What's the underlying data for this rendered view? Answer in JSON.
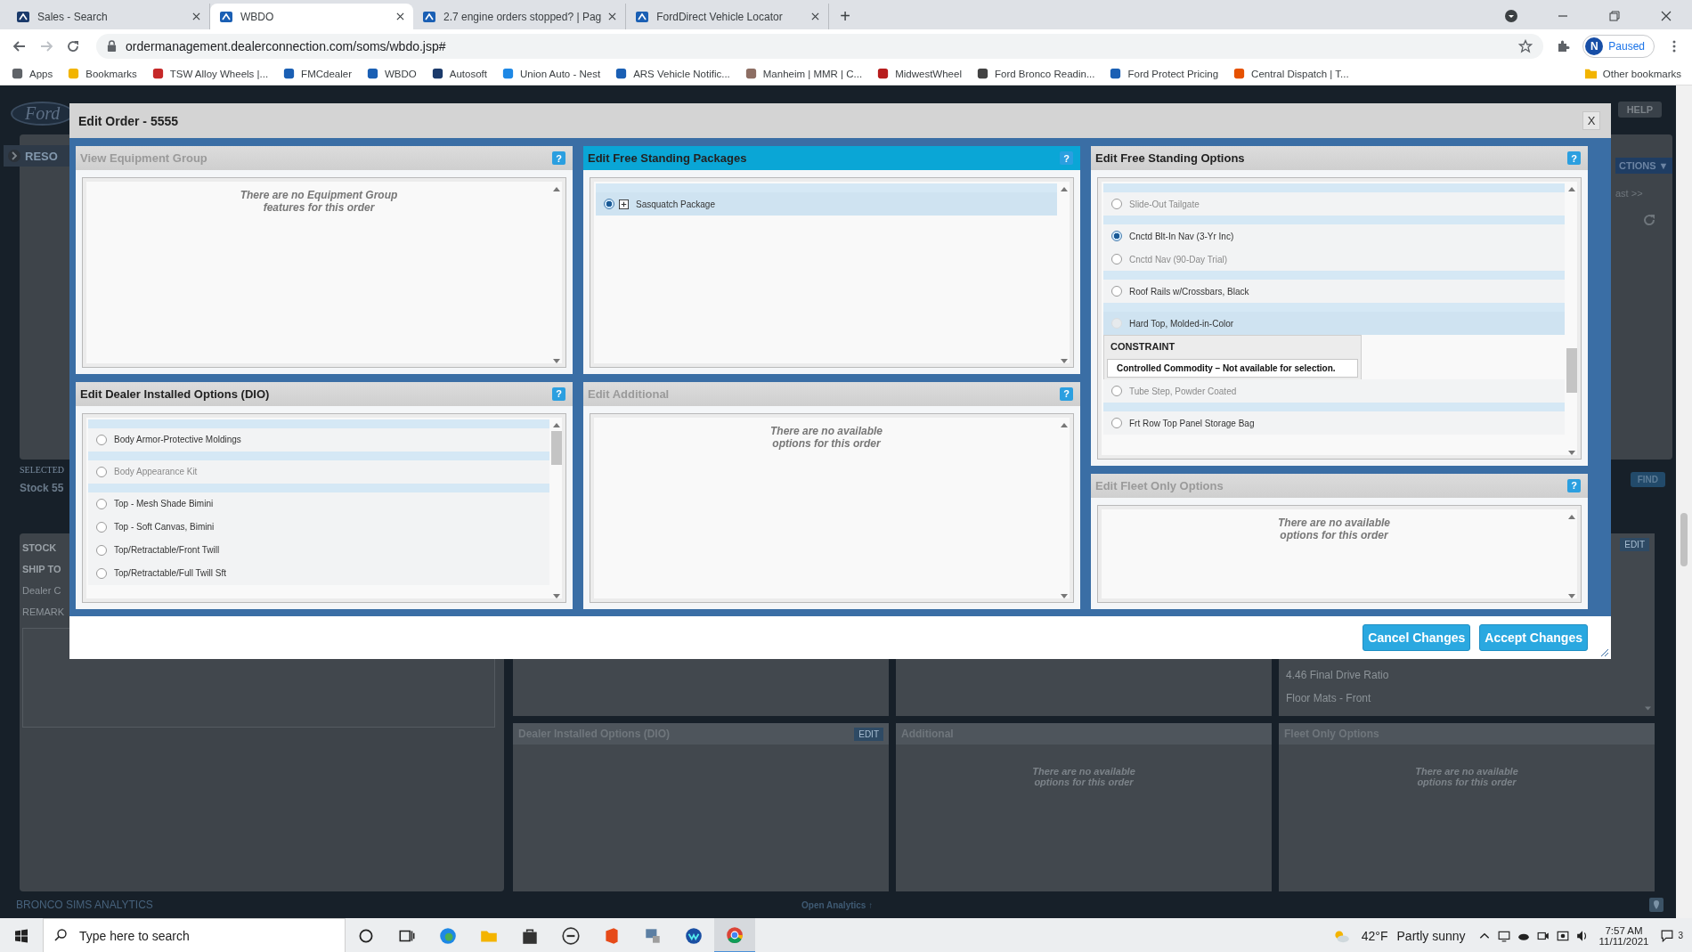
{
  "browser": {
    "tabs": [
      {
        "title": "Sales - Search",
        "selected": false
      },
      {
        "title": "WBDO",
        "selected": true
      },
      {
        "title": "2.7 engine orders stopped? | Pag",
        "selected": false
      },
      {
        "title": "FordDirect Vehicle Locator",
        "selected": false
      }
    ],
    "new_tab": "+",
    "address": "ordermanagement.dealerconnection.com/soms/wbdo.jsp#",
    "profile": {
      "initial": "N",
      "status": "Paused"
    },
    "bookmarks": [
      "Apps",
      "Bookmarks",
      "TSW Alloy Wheels |...",
      "FMCdealer",
      "WBDO",
      "Autosoft",
      "Union Auto - Nest",
      "ARS Vehicle Notific...",
      "Manheim | MMR | C...",
      "MidwestWheel",
      "Ford Bronco Readin...",
      "Ford Protect Pricing",
      "Central Dispatch | T..."
    ],
    "other_bookmarks": "Other bookmarks"
  },
  "page": {
    "logo": "Ford",
    "help": "HELP",
    "sidebar_button": "RESO",
    "actions": "CTIONS ▼",
    "last": "ast >>",
    "selected_label": "SELECTED",
    "stock_title": "Stock 55",
    "find": "FIND",
    "details": [
      "STOCK",
      "SHIP TO",
      "Dealer C",
      "REMARK"
    ],
    "features_edit": "EDIT",
    "features": [
      "4.46 Final Drive Ratio",
      "Floor Mats - Front"
    ],
    "cards": [
      {
        "title": "Dealer Installed Options (DIO)",
        "edit": "EDIT"
      },
      {
        "title": "Additional",
        "message": "There are no available\noptions for this order"
      },
      {
        "title": "Fleet Only Options",
        "message": "There are no available\noptions for this order"
      }
    ],
    "analytics": "BRONCO SIMS ANALYTICS",
    "open_analytics": "Open Analytics ↑"
  },
  "dialog": {
    "title": "Edit Order - 5555",
    "close": "X",
    "columns": [
      [
        {
          "title": "View Equipment Group",
          "selected": false,
          "disabled": true,
          "help": "?",
          "kind": "message",
          "message": "There are no Equipment Group\nfeatures for this order"
        },
        {
          "title": "Edit Dealer Installed Options (DIO)",
          "selected": false,
          "disabled": false,
          "help": "?",
          "kind": "options",
          "groups": [
            [
              {
                "label": "Body Armor-Protective Moldings",
                "selected": false,
                "disabled": false,
                "highlighted": false
              }
            ],
            [
              {
                "label": "Body Appearance Kit",
                "selected": false,
                "disabled": true,
                "highlighted": false
              }
            ],
            [
              {
                "label": "Top - Mesh Shade Bimini",
                "selected": false,
                "disabled": false,
                "highlighted": false
              },
              {
                "label": "Top - Soft Canvas, Bimini",
                "selected": false,
                "disabled": false,
                "highlighted": false
              },
              {
                "label": "Top/Retractable/Front Twill",
                "selected": false,
                "disabled": false,
                "highlighted": false
              },
              {
                "label": "Top/Retractable/Full Twill Sft",
                "selected": false,
                "disabled": false,
                "highlighted": false
              }
            ]
          ]
        }
      ],
      [
        {
          "title": "Edit Free Standing Packages",
          "selected": true,
          "disabled": false,
          "help": "?",
          "kind": "packages",
          "groups": [
            [
              {
                "label": "Sasquatch Package",
                "selected": true,
                "disabled": false,
                "highlighted": true
              }
            ]
          ]
        },
        {
          "title": "Edit Additional",
          "selected": false,
          "disabled": true,
          "help": "?",
          "kind": "message",
          "message": "There are no available\noptions for this order"
        }
      ],
      [
        {
          "title": "Edit Free Standing Options",
          "selected": false,
          "disabled": false,
          "help": "?",
          "kind": "options",
          "groups": [
            [
              {
                "label": "Slide-Out Tailgate",
                "selected": false,
                "disabled": true,
                "highlighted": false
              }
            ],
            [
              {
                "label": "Cnctd Blt-In Nav (3-Yr Inc)",
                "selected": true,
                "disabled": false,
                "highlighted": false
              },
              {
                "label": "Cnctd Nav (90-Day Trial)",
                "selected": false,
                "disabled": true,
                "highlighted": false
              }
            ],
            [
              {
                "label": "Roof Rails w/Crossbars, Black",
                "selected": false,
                "disabled": false,
                "highlighted": false
              }
            ],
            [
              {
                "label": "Hard Top, Molded-in-Color",
                "selected": false,
                "disabled": false,
                "highlighted": true,
                "constraint": {
                  "title": "CONSTRAINT",
                  "message": "Controlled Commodity – Not available for selection."
                }
              },
              {
                "label": "Tube Step, Powder Coated",
                "selected": false,
                "disabled": true,
                "highlighted": false
              }
            ],
            [
              {
                "label": "Frt Row Top Panel Storage Bag",
                "selected": false,
                "disabled": false,
                "highlighted": false
              }
            ]
          ]
        },
        {
          "title": "Edit Fleet Only Options",
          "selected": false,
          "disabled": true,
          "help": "?",
          "kind": "message",
          "message": "There are no available\noptions for this order"
        }
      ]
    ],
    "buttons": [
      "Cancel Changes",
      "Accept Changes"
    ]
  },
  "taskbar": {
    "search_placeholder": "Type here to search",
    "temperature": "42°F",
    "weather": "Partly sunny",
    "time": "7:57 AM",
    "date": "11/11/2021",
    "notifications": "3"
  }
}
